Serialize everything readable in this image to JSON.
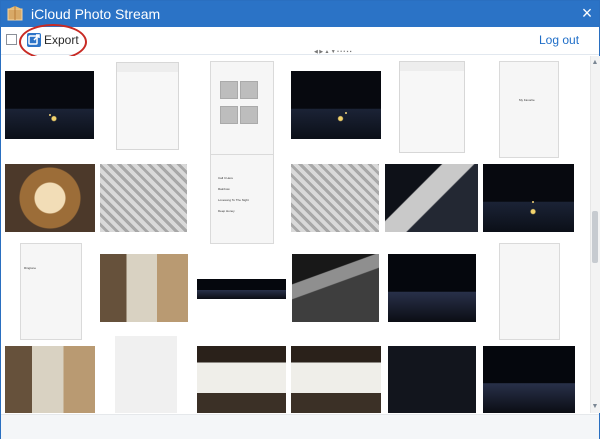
{
  "window": {
    "title": "iCloud Photo Stream",
    "close_label": "×"
  },
  "toolbar": {
    "export_label": "Export",
    "logout_label": "Log out",
    "mini_strip": "◀ ▶ ▲ ▼ • • • ▪ ▪"
  },
  "photos": [
    {
      "name": "photo-night-1"
    },
    {
      "name": "photo-chat-screenshot-1"
    },
    {
      "name": "photo-phone-gallery"
    },
    {
      "name": "photo-night-2"
    },
    {
      "name": "photo-chat-screenshot-2"
    },
    {
      "name": "photo-phone-list-1"
    },
    {
      "name": "photo-food-cake"
    },
    {
      "name": "photo-bird-1"
    },
    {
      "name": "photo-music-list"
    },
    {
      "name": "photo-bird-2"
    },
    {
      "name": "photo-metal-structure"
    },
    {
      "name": "photo-night-city"
    },
    {
      "name": "photo-settings-list"
    },
    {
      "name": "photo-cup"
    },
    {
      "name": "photo-wide-night"
    },
    {
      "name": "photo-street"
    },
    {
      "name": "photo-dark-city-2"
    },
    {
      "name": "photo-phone-list-2"
    },
    {
      "name": "photo-cup-2"
    },
    {
      "name": "photo-sketch-chat"
    },
    {
      "name": "photo-waffle"
    },
    {
      "name": "photo-dinner"
    },
    {
      "name": "photo-dark-blank"
    },
    {
      "name": "photo-night-city-2"
    }
  ],
  "phone_texts": {
    "music_items": [
      "Call It Here",
      "Rainbow",
      "Lovesong To The Night",
      "Deep Honey"
    ],
    "list_label": "My Favorite",
    "settings_label": "Ringtone"
  },
  "scroll": {
    "up_label": "▲",
    "down_label": "▼"
  }
}
